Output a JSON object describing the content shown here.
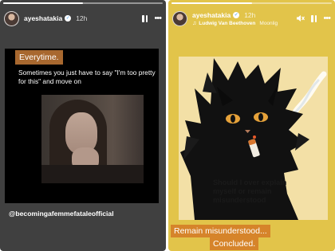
{
  "left_story": {
    "user": {
      "username": "ayeshatakia",
      "time": "12h"
    },
    "progress_fraction": 0.5,
    "sticker_label": "Everytime.",
    "quote": "Sometimes you just have to say  \"I'm too pretty for this\" and move on",
    "handle": "@becomingafemmefataleofficial",
    "icons": {
      "pause": "pause-icon",
      "more": "more-icon",
      "verified": "verified-badge-icon"
    }
  },
  "right_story": {
    "user": {
      "username": "ayeshatakia",
      "time": "12h"
    },
    "progress_fraction": 0.5,
    "music": {
      "artist": "Ludwig Van Beethoven",
      "track": "Moonlig"
    },
    "art_caption": "Should I over explain myself or remain misunderstood",
    "caption_line1": "Remain misunderstood...",
    "caption_line2": "Concluded.",
    "icons": {
      "mute": "mute-icon",
      "pause": "pause-icon",
      "more": "more-icon",
      "music": "music-note-icon"
    }
  },
  "colors": {
    "left_background": "#404040",
    "right_background": "#e2c44a",
    "sticker_brown": "#a8682f",
    "caption_orange": "#d6842a"
  }
}
